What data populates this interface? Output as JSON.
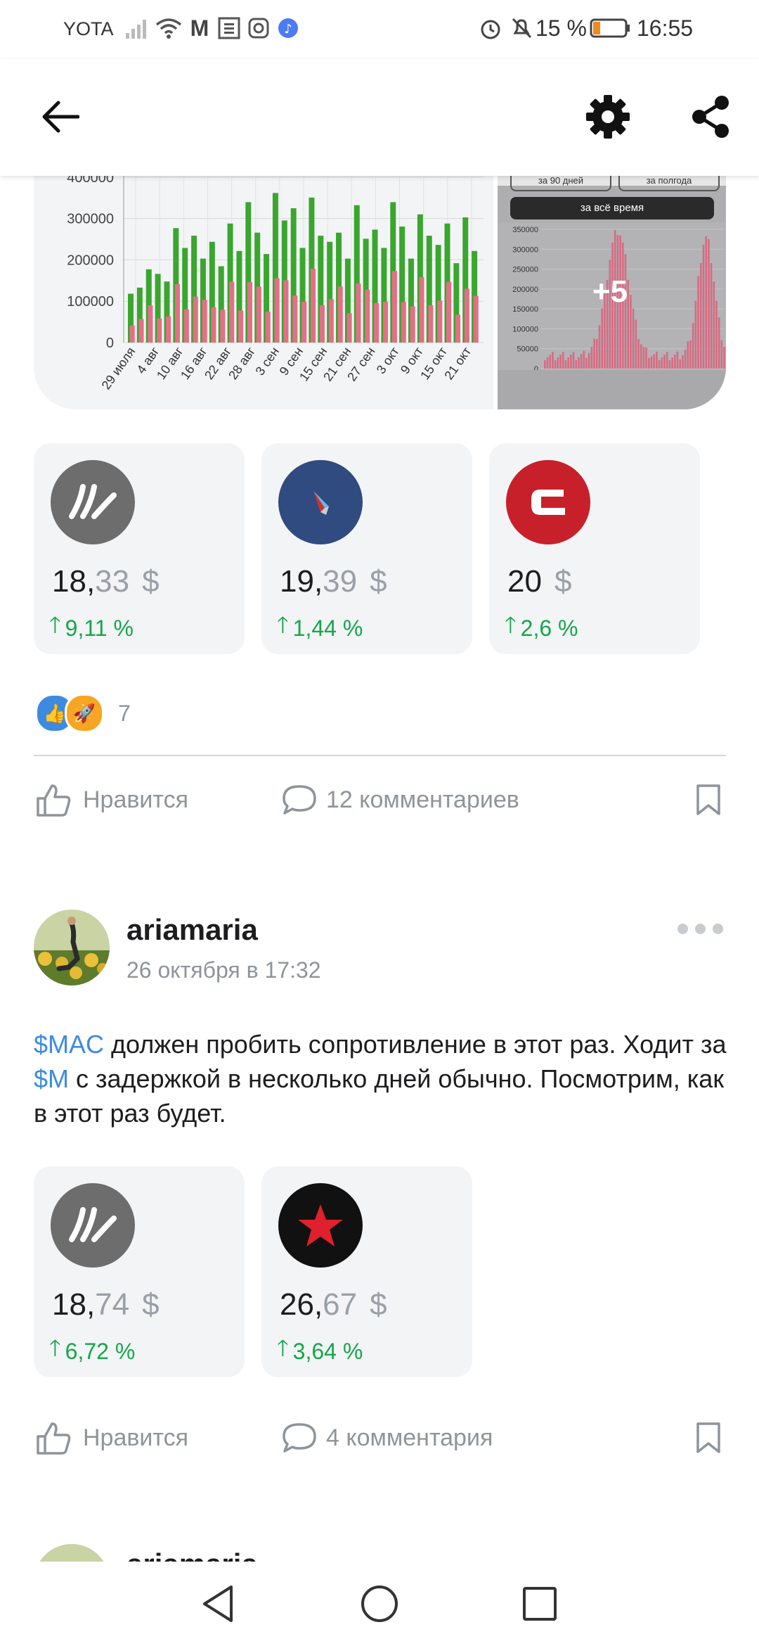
{
  "status_bar": {
    "carrier": "YOTA",
    "battery": "15 %",
    "time": "16:55"
  },
  "gallery": {
    "main_chart": {
      "y_ticks": [
        "400000",
        "300000",
        "200000",
        "100000",
        "0"
      ],
      "x_ticks": [
        "29 июля",
        "4 авг",
        "10 авг",
        "16 авг",
        "22 авг",
        "28 авг",
        "3 сен",
        "9 сен",
        "15 сен",
        "21 сен",
        "27 сен",
        "3 окт",
        "9 окт",
        "15 окт",
        "21 окт"
      ]
    },
    "thumb": {
      "tab_left": "за 90 дней",
      "tab_right": "за полгода",
      "tab_all": "за всё время",
      "y_ticks": [
        "350000",
        "300000",
        "250000",
        "200000",
        "150000",
        "100000",
        "50000",
        "0"
      ],
      "more_label": "+5"
    }
  },
  "post1": {
    "tickers": [
      {
        "int": "18,",
        "dec": "33",
        "cur": "$",
        "change": "9,11 %",
        "logo": "waves-logo"
      },
      {
        "int": "19,",
        "dec": "39",
        "cur": "$",
        "change": "1,44 %",
        "logo": "american-airlines-logo"
      },
      {
        "int": "20",
        "dec": "",
        "cur": "$",
        "change": "2,6 %",
        "logo": "c-logo"
      }
    ],
    "reactions_count": "7",
    "like_label": "Нравится",
    "comments_label": "12 комментариев"
  },
  "post2": {
    "author": "ariamaria",
    "date": "26 октября в 17:32",
    "text_t1": "$MAC",
    "text_p1": " должен пробить сопротивление в этот раз. Ходит за ",
    "text_t2": "$M",
    "text_p2": " с задержкой в несколько дней обычно. Посмотрим, как в этот раз будет.",
    "tickers": [
      {
        "int": "18,",
        "dec": "74",
        "cur": "$",
        "change": "6,72 %",
        "logo": "waves-logo"
      },
      {
        "int": "26,",
        "dec": "67",
        "cur": "$",
        "change": "3,64 %",
        "logo": "star-logo"
      }
    ],
    "like_label": "Нравится",
    "comments_label": "4 комментария"
  },
  "post3": {
    "author_partial": "ariamaria"
  },
  "colors": {
    "accent": "#3d8be0",
    "positive": "#15a64a",
    "muted": "#8f949b"
  }
}
